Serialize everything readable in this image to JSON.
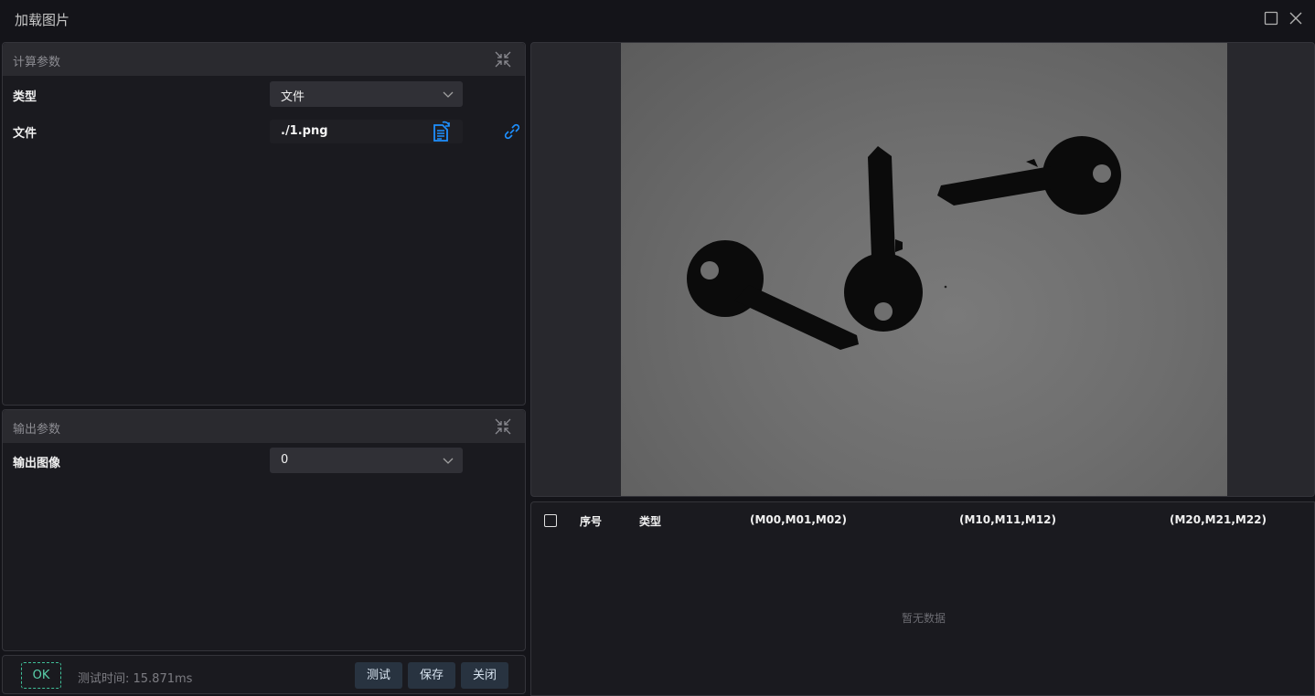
{
  "window": {
    "title": "加载图片"
  },
  "calc_params": {
    "header": "计算参数",
    "type_label": "类型",
    "type_value": "文件",
    "file_label": "文件",
    "file_value": "./1.png"
  },
  "output_params": {
    "header": "输出参数",
    "image_label": "输出图像",
    "image_value": "0"
  },
  "footer": {
    "ok_label": "OK",
    "test_time": "测试时间: 15.871ms",
    "test_label": "测试",
    "save_label": "保存",
    "close_label": "关闭"
  },
  "table": {
    "columns": [
      "序号",
      "类型",
      "(M00,M01,M02)",
      "(M10,M11,M12)",
      "(M20,M21,M22)"
    ],
    "empty_text": "暂无数据"
  },
  "colors": {
    "accent": "#1e90ff",
    "ok": "#3fbf98"
  },
  "icons": {
    "maximize": "square-icon",
    "close": "close-icon",
    "collapse": "collapse-icon",
    "file": "file-select-icon",
    "link": "link-icon",
    "dropdown": "chevron-down-icon"
  }
}
